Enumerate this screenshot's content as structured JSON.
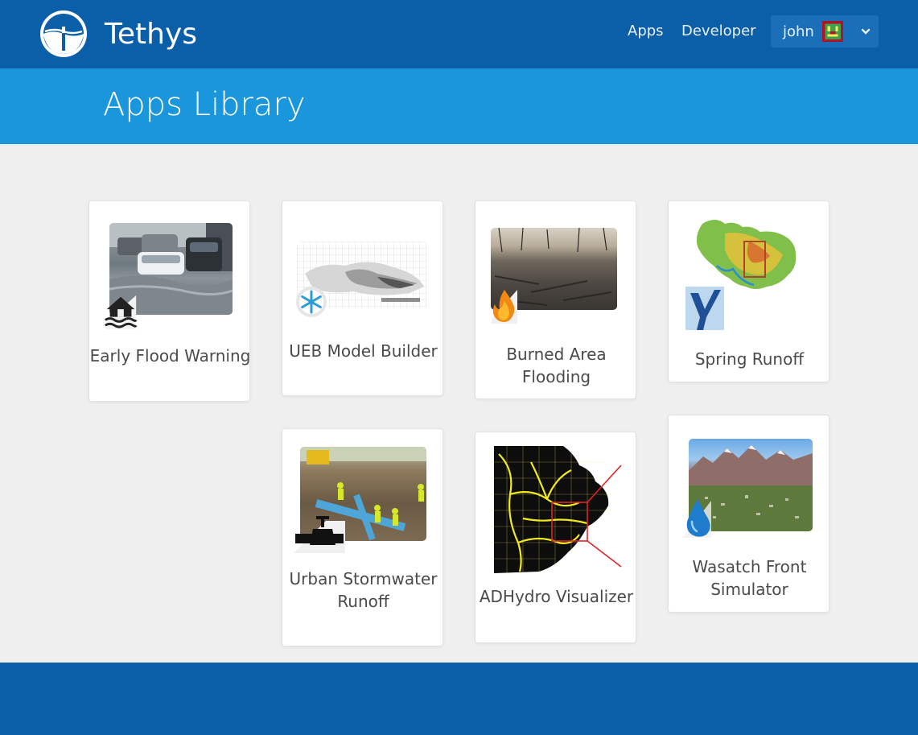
{
  "header": {
    "brand": "Tethys",
    "nav": [
      {
        "label": "Apps"
      },
      {
        "label": "Developer"
      }
    ],
    "user": {
      "name": "john"
    }
  },
  "page": {
    "title": "Apps Library"
  },
  "apps": [
    {
      "name": "Early Flood Warning",
      "icon": "house-flood-icon"
    },
    {
      "name": "UEB Model Builder",
      "icon": "snowflake-icon"
    },
    {
      "name": "Burned Area Flooding",
      "icon": "fire-icon"
    },
    {
      "name": "Spring Runoff",
      "icon": "y-logo-icon"
    },
    {
      "name": "Urban Stormwater Runoff",
      "icon": "valve-icon"
    },
    {
      "name": "ADHydro Visualizer",
      "icon": "mesh-map-icon"
    },
    {
      "name": "Wasatch Front Simulator",
      "icon": "water-drop-icon"
    }
  ],
  "colors": {
    "topbar": "#0b5ea8",
    "subheader": "#1a96dd",
    "background": "#efefef",
    "card": "#ffffff"
  }
}
